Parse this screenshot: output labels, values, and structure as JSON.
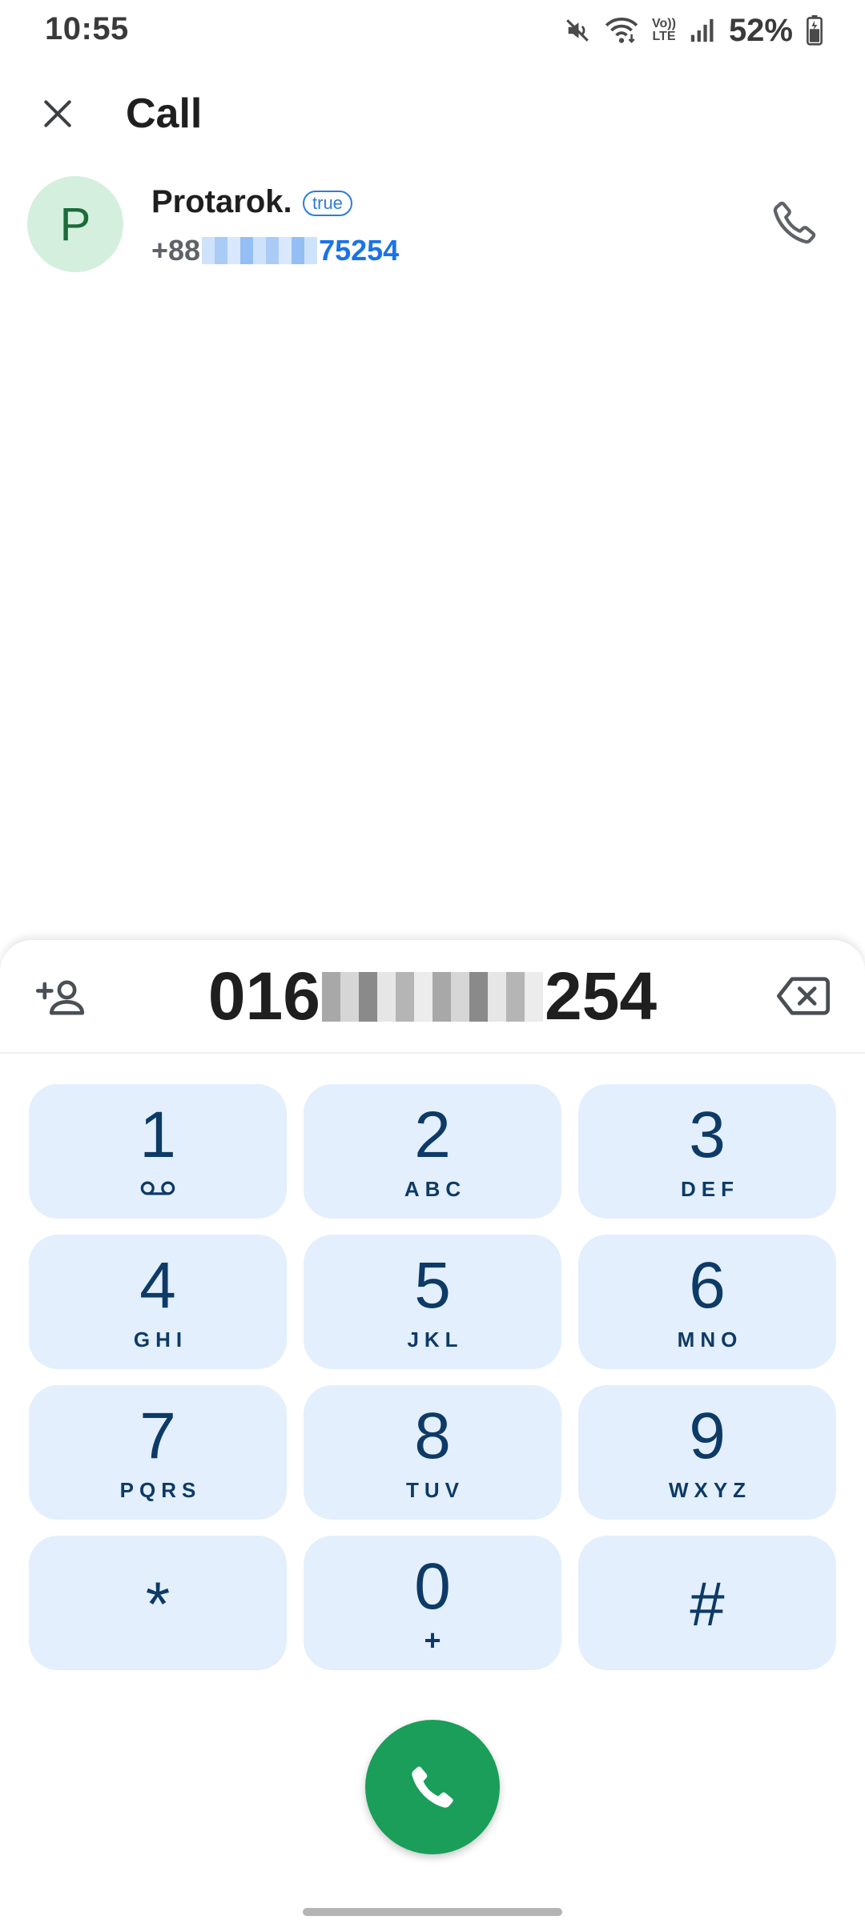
{
  "status_bar": {
    "time": "10:55",
    "battery_percent": "52%",
    "volte_label_top": "Vo))",
    "volte_label_bottom": "LTE",
    "icons": [
      "mute-icon",
      "wifi-icon",
      "volte-icon",
      "signal-icon",
      "battery-icon"
    ]
  },
  "top_bar": {
    "title": "Call",
    "close_icon": "close-icon"
  },
  "contact": {
    "avatar_letter": "P",
    "name": "Protarok.",
    "badge": "true",
    "number_prefix": "+88",
    "number_suffix": "75254",
    "call_icon": "phone-icon"
  },
  "dialer": {
    "number_start": "016",
    "number_end": "254",
    "add_contact_icon": "add-contact-icon",
    "backspace_icon": "backspace-icon",
    "keys": [
      {
        "digit": "1",
        "letters": ""
      },
      {
        "digit": "2",
        "letters": "ABC"
      },
      {
        "digit": "3",
        "letters": "DEF"
      },
      {
        "digit": "4",
        "letters": "GHI"
      },
      {
        "digit": "5",
        "letters": "JKL"
      },
      {
        "digit": "6",
        "letters": "MNO"
      },
      {
        "digit": "7",
        "letters": "PQRS"
      },
      {
        "digit": "8",
        "letters": "TUV"
      },
      {
        "digit": "9",
        "letters": "WXYZ"
      },
      {
        "digit": "*",
        "letters": ""
      },
      {
        "digit": "0",
        "letters": "+"
      },
      {
        "digit": "#",
        "letters": ""
      }
    ],
    "call_button_icon": "phone-icon"
  },
  "colors": {
    "key_bg": "#e3effc",
    "key_text": "#0d3a66",
    "call_green": "#1a9e5a",
    "link_blue": "#1a73e8"
  }
}
